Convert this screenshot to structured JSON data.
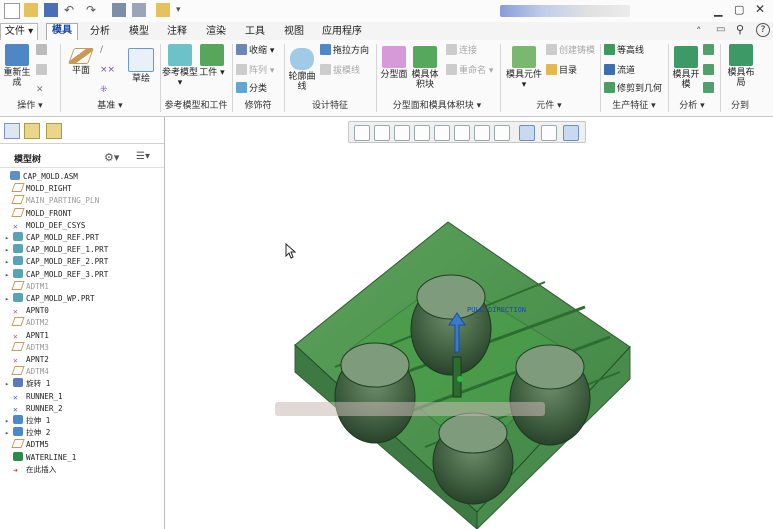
{
  "menu": {
    "file": "文件",
    "tabs": [
      "模具",
      "分析",
      "模型",
      "注释",
      "渲染",
      "工具",
      "视图",
      "应用程序"
    ],
    "active_index": 0
  },
  "ribbon": {
    "regenerate": "重新生成",
    "plane": "平面",
    "sketch": "草绘",
    "ref_model": "参考模型",
    "workpiece": "工件",
    "shrink": "收缩",
    "array": "阵列",
    "classify": "分类",
    "silhouette": "轮廓曲线",
    "pull_dir": "拖拉方向",
    "draft_check": "拔模线",
    "parting_surface": "分型面",
    "mold_volume": "模具体积块",
    "connect": "连接",
    "rename": "重命名",
    "mold_component": "模具元件",
    "create_casting": "创建铸模",
    "catalog": "目录",
    "contour": "等高线",
    "flow": "流道",
    "trim_geom": "修剪到几何",
    "mold_open": "模具开模",
    "mold_layout": "模具布局",
    "groups": {
      "operations": "操作",
      "datum": "基准",
      "ref_model_group": "参考模型和工件",
      "modifiers": "修饰符",
      "design_features": "设计特征",
      "parting": "分型面和模具体积块",
      "components": "元件",
      "production": "生产特征",
      "analysis": "分析",
      "distribute": "分到"
    }
  },
  "tree": {
    "title": "模型树",
    "rows": [
      {
        "label": "CAP_MOLD.ASM",
        "icon": "assembly",
        "exp": "",
        "indent": 0,
        "grey": false
      },
      {
        "label": "MOLD_RIGHT",
        "icon": "plane",
        "exp": "",
        "indent": 1,
        "grey": false
      },
      {
        "label": "MAIN_PARTING_PLN",
        "icon": "plane",
        "exp": "",
        "indent": 1,
        "grey": true
      },
      {
        "label": "MOLD_FRONT",
        "icon": "plane",
        "exp": "",
        "indent": 1,
        "grey": false
      },
      {
        "label": "MOLD_DEF_CSYS",
        "icon": "csys",
        "exp": "",
        "indent": 1,
        "grey": false
      },
      {
        "label": "CAP_MOLD_REF.PRT",
        "icon": "part",
        "exp": "▸",
        "indent": 1,
        "grey": false
      },
      {
        "label": "CAP_MOLD_REF_1.PRT",
        "icon": "part",
        "exp": "▸",
        "indent": 1,
        "grey": false
      },
      {
        "label": "CAP_MOLD_REF_2.PRT",
        "icon": "part",
        "exp": "▸",
        "indent": 1,
        "grey": false
      },
      {
        "label": "CAP_MOLD_REF_3.PRT",
        "icon": "part",
        "exp": "▸",
        "indent": 1,
        "grey": false
      },
      {
        "label": "ADTM1",
        "icon": "plane",
        "exp": "",
        "indent": 1,
        "grey": true
      },
      {
        "label": "CAP_MOLD_WP.PRT",
        "icon": "part",
        "exp": "▸",
        "indent": 1,
        "grey": false
      },
      {
        "label": "APNT0",
        "icon": "point",
        "exp": "",
        "indent": 1,
        "grey": false
      },
      {
        "label": "ADTM2",
        "icon": "plane",
        "exp": "",
        "indent": 1,
        "grey": true
      },
      {
        "label": "APNT1",
        "icon": "point",
        "exp": "",
        "indent": 1,
        "grey": false
      },
      {
        "label": "ADTM3",
        "icon": "plane",
        "exp": "",
        "indent": 1,
        "grey": true
      },
      {
        "label": "APNT2",
        "icon": "point",
        "exp": "",
        "indent": 1,
        "grey": false
      },
      {
        "label": "ADTM4",
        "icon": "plane",
        "exp": "",
        "indent": 1,
        "grey": true
      },
      {
        "label": "旋转 1",
        "icon": "revolve",
        "exp": "▸",
        "indent": 1,
        "grey": false
      },
      {
        "label": "RUNNER_1",
        "icon": "runner",
        "exp": "",
        "indent": 1,
        "grey": false
      },
      {
        "label": "RUNNER_2",
        "icon": "runner",
        "exp": "",
        "indent": 1,
        "grey": false
      },
      {
        "label": "拉伸 1",
        "icon": "extrude",
        "exp": "▸",
        "indent": 1,
        "grey": false
      },
      {
        "label": "拉伸 2",
        "icon": "extrude",
        "exp": "▸",
        "indent": 1,
        "grey": false
      },
      {
        "label": "ADTM5",
        "icon": "plane",
        "exp": "",
        "indent": 1,
        "grey": false
      },
      {
        "label": "WATERLINE_1",
        "icon": "waterline",
        "exp": "",
        "indent": 1,
        "grey": false
      },
      {
        "label": "在此插入",
        "icon": "insert",
        "exp": "",
        "indent": 1,
        "grey": false
      }
    ]
  },
  "graphics": {
    "annotation": "PULL DIRECTION"
  },
  "colors": {
    "mold": "#3d8a3d",
    "mold_dark": "#1f5a24",
    "accent": "#1a4aa8",
    "insert_arrow": "#c0392b"
  }
}
